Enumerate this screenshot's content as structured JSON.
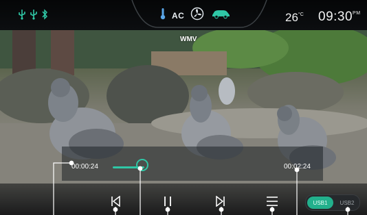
{
  "status_bar": {
    "icons": [
      "usb-icon",
      "usb-icon",
      "bluetooth-icon"
    ],
    "climate": {
      "ac_label": "AC",
      "icons": [
        "temperature-icon",
        "ac-label",
        "fan-icon",
        "car-air-icon"
      ]
    },
    "temperature": "26",
    "temperature_unit": "°C",
    "time": "09:30",
    "time_period": "PM"
  },
  "video": {
    "format": "WMV"
  },
  "progress": {
    "elapsed": "00:00:24",
    "total": "00:02:24",
    "fraction": 0.17
  },
  "controls": {
    "buttons": [
      "previous-icon",
      "pause-icon",
      "next-icon",
      "playlist-icon"
    ],
    "sources": [
      "USB1",
      "USB2"
    ],
    "active_source": "USB1"
  },
  "colors": {
    "accent": "#2fc7a6",
    "status_bg": "#0a0c0e"
  }
}
